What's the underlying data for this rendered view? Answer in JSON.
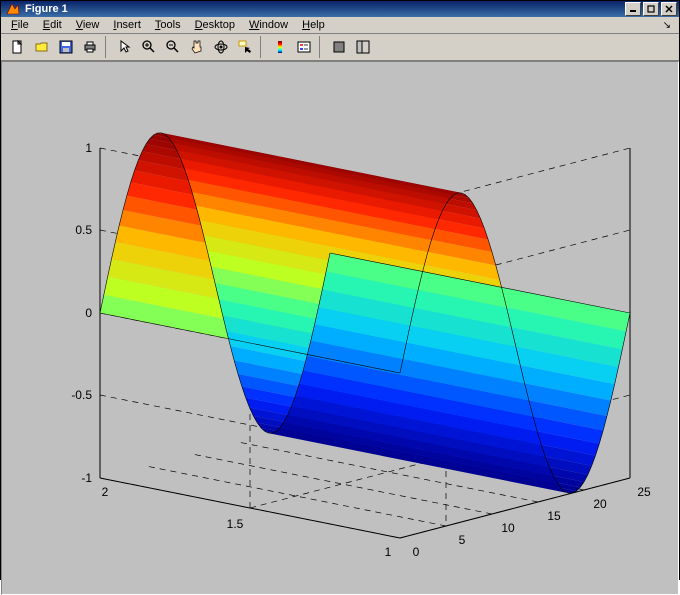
{
  "window": {
    "title": "Figure 1"
  },
  "menus": {
    "file": "File",
    "edit": "Edit",
    "view": "View",
    "insert": "Insert",
    "tools": "Tools",
    "desktop": "Desktop",
    "window": "Window",
    "help": "Help"
  },
  "toolbar_icons": {
    "new": "new-file-icon",
    "open": "open-folder-icon",
    "save": "save-icon",
    "print": "print-icon",
    "pointer": "arrow-pointer-icon",
    "zoomin": "zoom-in-icon",
    "zoomout": "zoom-out-icon",
    "pan": "hand-pan-icon",
    "rotate": "rotate-3d-icon",
    "datacursor": "data-cursor-icon",
    "colorbar": "insert-colorbar-icon",
    "legend": "insert-legend-icon",
    "hide": "hide-tools-icon",
    "dock": "dock-figure-icon"
  },
  "chart_data": {
    "type": "surface",
    "title": "",
    "x": {
      "label": "",
      "range": [
        0,
        25
      ],
      "ticks": [
        0,
        5,
        10,
        15,
        20,
        25
      ]
    },
    "y": {
      "label": "",
      "range": [
        1,
        2
      ],
      "ticks": [
        1,
        1.5,
        2
      ]
    },
    "z": {
      "label": "",
      "range": [
        -1,
        1
      ],
      "ticks": [
        -1,
        -0.5,
        0,
        0.5,
        1
      ]
    },
    "function": "z = sin(x * 2*pi / 25), independent of y",
    "colormap": "jet",
    "note": "Surface colored by z-value from -1 (blue) to +1 (red)"
  }
}
